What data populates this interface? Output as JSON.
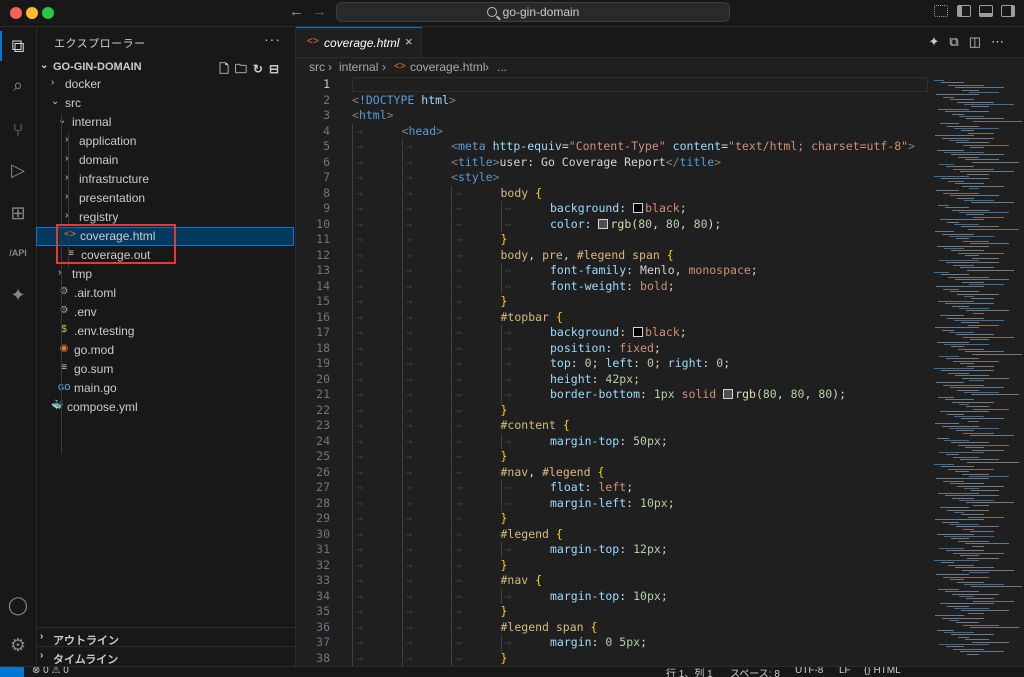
{
  "window": {
    "command_center": "go-gin-domain",
    "back_arrow": "←",
    "forward_arrow": "→"
  },
  "activity_bar": [
    {
      "name": "explorer-icon",
      "glyph": "⧉",
      "active": true
    },
    {
      "name": "search-icon",
      "glyph": "⌕"
    },
    {
      "name": "source-control-icon",
      "glyph": "⑂"
    },
    {
      "name": "run-debug-icon",
      "glyph": "▷"
    },
    {
      "name": "extensions-icon",
      "glyph": "⊞"
    },
    {
      "name": "api-icon",
      "glyph": "/API"
    },
    {
      "name": "copilot-icon",
      "glyph": "✦"
    }
  ],
  "activity_bottom": [
    {
      "name": "account-icon",
      "glyph": "◯"
    },
    {
      "name": "settings-gear-icon",
      "glyph": "⚙"
    }
  ],
  "sidebar": {
    "title": "エクスプローラー",
    "more": "···",
    "project": "GO-GIN-DOMAIN",
    "outline": "アウトライン",
    "timeline": "タイムライン"
  },
  "tree": [
    {
      "name": "docker",
      "type": "folder",
      "open": false,
      "depth": 1
    },
    {
      "name": "src",
      "type": "folder",
      "open": true,
      "depth": 1
    },
    {
      "name": "internal",
      "type": "folder",
      "open": true,
      "depth": 2
    },
    {
      "name": "application",
      "type": "folder",
      "open": false,
      "depth": 3
    },
    {
      "name": "domain",
      "type": "folder",
      "open": false,
      "depth": 3
    },
    {
      "name": "infrastructure",
      "type": "folder",
      "open": false,
      "depth": 3
    },
    {
      "name": "presentation",
      "type": "folder",
      "open": false,
      "depth": 3
    },
    {
      "name": "registry",
      "type": "folder",
      "open": false,
      "depth": 3
    },
    {
      "name": "coverage.html",
      "type": "file",
      "icon": "<>",
      "color": "#e37933",
      "depth": 3,
      "selected": true
    },
    {
      "name": "coverage.out",
      "type": "file",
      "icon": "≡",
      "color": "#cccccc",
      "depth": 3
    },
    {
      "name": "tmp",
      "type": "folder",
      "open": false,
      "depth": 2
    },
    {
      "name": ".air.toml",
      "type": "file",
      "icon": "⚙",
      "color": "#9aa4ad",
      "depth": 2
    },
    {
      "name": ".env",
      "type": "file",
      "icon": "⚙",
      "color": "#9aa4ad",
      "depth": 2
    },
    {
      "name": ".env.testing",
      "type": "file",
      "icon": "$",
      "color": "#cbcb41",
      "depth": 2
    },
    {
      "name": "go.mod",
      "type": "file",
      "icon": "◉",
      "color": "#e37933",
      "depth": 2
    },
    {
      "name": "go.sum",
      "type": "file",
      "icon": "≡",
      "color": "#cccccc",
      "depth": 2
    },
    {
      "name": "main.go",
      "type": "file",
      "icon": "GO",
      "color": "#519aba",
      "depth": 2
    },
    {
      "name": "compose.yml",
      "type": "file",
      "icon": "🐳",
      "color": "#e0443e",
      "depth": 1
    }
  ],
  "editor": {
    "tab_label": "coverage.html",
    "tab_close": "×",
    "breadcrumb": [
      "src",
      "internal",
      "coverage.html",
      "..."
    ]
  },
  "code_lines": [
    {
      "indent": 0,
      "tokens": []
    },
    {
      "indent": 0,
      "tokens": [
        [
          "tk-gray",
          "<"
        ],
        [
          "tk-tag",
          "!DOCTYPE"
        ],
        [
          "tk-txt",
          " "
        ],
        [
          "tk-attr",
          "html"
        ],
        [
          "tk-gray",
          ">"
        ]
      ]
    },
    {
      "indent": 0,
      "tokens": [
        [
          "tk-gray",
          "<"
        ],
        [
          "tk-tag",
          "html"
        ],
        [
          "tk-gray",
          ">"
        ]
      ]
    },
    {
      "indent": 1,
      "tokens": [
        [
          "tk-gray",
          "<"
        ],
        [
          "tk-tag",
          "head"
        ],
        [
          "tk-gray",
          ">"
        ]
      ]
    },
    {
      "indent": 2,
      "tokens": [
        [
          "tk-gray",
          "<"
        ],
        [
          "tk-tag",
          "meta"
        ],
        [
          "tk-txt",
          " "
        ],
        [
          "tk-attr",
          "http-equiv"
        ],
        [
          "tk-txt",
          "="
        ],
        [
          "tk-str",
          "\"Content-Type\""
        ],
        [
          "tk-txt",
          " "
        ],
        [
          "tk-attr",
          "content"
        ],
        [
          "tk-txt",
          "="
        ],
        [
          "tk-str",
          "\"text/html; charset=utf-8\""
        ],
        [
          "tk-gray",
          ">"
        ]
      ]
    },
    {
      "indent": 2,
      "tokens": [
        [
          "tk-gray",
          "<"
        ],
        [
          "tk-tag",
          "title"
        ],
        [
          "tk-gray",
          ">"
        ],
        [
          "tk-txt",
          "user: Go Coverage Report"
        ],
        [
          "tk-gray",
          "</"
        ],
        [
          "tk-tag",
          "title"
        ],
        [
          "tk-gray",
          ">"
        ]
      ]
    },
    {
      "indent": 2,
      "tokens": [
        [
          "tk-gray",
          "<"
        ],
        [
          "tk-tag",
          "style"
        ],
        [
          "tk-gray",
          ">"
        ]
      ]
    },
    {
      "indent": 3,
      "tokens": [
        [
          "tk-sel",
          "body"
        ],
        [
          "tk-txt",
          " "
        ],
        [
          "tk-brace",
          "{"
        ]
      ]
    },
    {
      "indent": 4,
      "tokens": [
        [
          "tk-prop",
          "background"
        ],
        [
          "tk-txt",
          ": "
        ],
        [
          "swatch",
          "#000000"
        ],
        [
          "tk-val",
          "black"
        ],
        [
          "tk-txt",
          ";"
        ]
      ]
    },
    {
      "indent": 4,
      "tokens": [
        [
          "tk-prop",
          "color"
        ],
        [
          "tk-txt",
          ": "
        ],
        [
          "swatch",
          "#505050"
        ],
        [
          "tk-fn",
          "rgb"
        ],
        [
          "tk-txt",
          "("
        ],
        [
          "tk-num",
          "80"
        ],
        [
          "tk-txt",
          ", "
        ],
        [
          "tk-num",
          "80"
        ],
        [
          "tk-txt",
          ", "
        ],
        [
          "tk-num",
          "80"
        ],
        [
          "tk-txt",
          ");"
        ]
      ]
    },
    {
      "indent": 3,
      "tokens": [
        [
          "tk-brace",
          "}"
        ]
      ]
    },
    {
      "indent": 3,
      "tokens": [
        [
          "tk-sel",
          "body"
        ],
        [
          "tk-txt",
          ", "
        ],
        [
          "tk-sel",
          "pre"
        ],
        [
          "tk-txt",
          ", "
        ],
        [
          "tk-sel",
          "#legend span"
        ],
        [
          "tk-txt",
          " "
        ],
        [
          "tk-brace",
          "{"
        ]
      ]
    },
    {
      "indent": 4,
      "tokens": [
        [
          "tk-prop",
          "font-family"
        ],
        [
          "tk-txt",
          ": Menlo, "
        ],
        [
          "tk-val",
          "monospace"
        ],
        [
          "tk-txt",
          ";"
        ]
      ]
    },
    {
      "indent": 4,
      "tokens": [
        [
          "tk-prop",
          "font-weight"
        ],
        [
          "tk-txt",
          ": "
        ],
        [
          "tk-val",
          "bold"
        ],
        [
          "tk-txt",
          ";"
        ]
      ]
    },
    {
      "indent": 3,
      "tokens": [
        [
          "tk-brace",
          "}"
        ]
      ]
    },
    {
      "indent": 3,
      "tokens": [
        [
          "tk-sel",
          "#topbar"
        ],
        [
          "tk-txt",
          " "
        ],
        [
          "tk-brace",
          "{"
        ]
      ]
    },
    {
      "indent": 4,
      "tokens": [
        [
          "tk-prop",
          "background"
        ],
        [
          "tk-txt",
          ": "
        ],
        [
          "swatch",
          "#000000"
        ],
        [
          "tk-val",
          "black"
        ],
        [
          "tk-txt",
          ";"
        ]
      ]
    },
    {
      "indent": 4,
      "tokens": [
        [
          "tk-prop",
          "position"
        ],
        [
          "tk-txt",
          ": "
        ],
        [
          "tk-val",
          "fixed"
        ],
        [
          "tk-txt",
          ";"
        ]
      ]
    },
    {
      "indent": 4,
      "tokens": [
        [
          "tk-prop",
          "top"
        ],
        [
          "tk-txt",
          ": "
        ],
        [
          "tk-num",
          "0"
        ],
        [
          "tk-txt",
          "; "
        ],
        [
          "tk-prop",
          "left"
        ],
        [
          "tk-txt",
          ": "
        ],
        [
          "tk-num",
          "0"
        ],
        [
          "tk-txt",
          "; "
        ],
        [
          "tk-prop",
          "right"
        ],
        [
          "tk-txt",
          ": "
        ],
        [
          "tk-num",
          "0"
        ],
        [
          "tk-txt",
          ";"
        ]
      ]
    },
    {
      "indent": 4,
      "tokens": [
        [
          "tk-prop",
          "height"
        ],
        [
          "tk-txt",
          ": "
        ],
        [
          "tk-num",
          "42px"
        ],
        [
          "tk-txt",
          ";"
        ]
      ]
    },
    {
      "indent": 4,
      "tokens": [
        [
          "tk-prop",
          "border-bottom"
        ],
        [
          "tk-txt",
          ": "
        ],
        [
          "tk-num",
          "1px"
        ],
        [
          "tk-txt",
          " "
        ],
        [
          "tk-val",
          "solid"
        ],
        [
          "tk-txt",
          " "
        ],
        [
          "swatch",
          "#505050"
        ],
        [
          "tk-fn",
          "rgb"
        ],
        [
          "tk-txt",
          "("
        ],
        [
          "tk-num",
          "80"
        ],
        [
          "tk-txt",
          ", "
        ],
        [
          "tk-num",
          "80"
        ],
        [
          "tk-txt",
          ", "
        ],
        [
          "tk-num",
          "80"
        ],
        [
          "tk-txt",
          ");"
        ]
      ]
    },
    {
      "indent": 3,
      "tokens": [
        [
          "tk-brace",
          "}"
        ]
      ]
    },
    {
      "indent": 3,
      "tokens": [
        [
          "tk-sel",
          "#content"
        ],
        [
          "tk-txt",
          " "
        ],
        [
          "tk-brace",
          "{"
        ]
      ]
    },
    {
      "indent": 4,
      "tokens": [
        [
          "tk-prop",
          "margin-top"
        ],
        [
          "tk-txt",
          ": "
        ],
        [
          "tk-num",
          "50px"
        ],
        [
          "tk-txt",
          ";"
        ]
      ]
    },
    {
      "indent": 3,
      "tokens": [
        [
          "tk-brace",
          "}"
        ]
      ]
    },
    {
      "indent": 3,
      "tokens": [
        [
          "tk-sel",
          "#nav"
        ],
        [
          "tk-txt",
          ", "
        ],
        [
          "tk-sel",
          "#legend"
        ],
        [
          "tk-txt",
          " "
        ],
        [
          "tk-brace",
          "{"
        ]
      ]
    },
    {
      "indent": 4,
      "tokens": [
        [
          "tk-prop",
          "float"
        ],
        [
          "tk-txt",
          ": "
        ],
        [
          "tk-val",
          "left"
        ],
        [
          "tk-txt",
          ";"
        ]
      ]
    },
    {
      "indent": 4,
      "tokens": [
        [
          "tk-prop",
          "margin-left"
        ],
        [
          "tk-txt",
          ": "
        ],
        [
          "tk-num",
          "10px"
        ],
        [
          "tk-txt",
          ";"
        ]
      ]
    },
    {
      "indent": 3,
      "tokens": [
        [
          "tk-brace",
          "}"
        ]
      ]
    },
    {
      "indent": 3,
      "tokens": [
        [
          "tk-sel",
          "#legend"
        ],
        [
          "tk-txt",
          " "
        ],
        [
          "tk-brace",
          "{"
        ]
      ]
    },
    {
      "indent": 4,
      "tokens": [
        [
          "tk-prop",
          "margin-top"
        ],
        [
          "tk-txt",
          ": "
        ],
        [
          "tk-num",
          "12px"
        ],
        [
          "tk-txt",
          ";"
        ]
      ]
    },
    {
      "indent": 3,
      "tokens": [
        [
          "tk-brace",
          "}"
        ]
      ]
    },
    {
      "indent": 3,
      "tokens": [
        [
          "tk-sel",
          "#nav"
        ],
        [
          "tk-txt",
          " "
        ],
        [
          "tk-brace",
          "{"
        ]
      ]
    },
    {
      "indent": 4,
      "tokens": [
        [
          "tk-prop",
          "margin-top"
        ],
        [
          "tk-txt",
          ": "
        ],
        [
          "tk-num",
          "10px"
        ],
        [
          "tk-txt",
          ";"
        ]
      ]
    },
    {
      "indent": 3,
      "tokens": [
        [
          "tk-brace",
          "}"
        ]
      ]
    },
    {
      "indent": 3,
      "tokens": [
        [
          "tk-sel",
          "#legend span"
        ],
        [
          "tk-txt",
          " "
        ],
        [
          "tk-brace",
          "{"
        ]
      ]
    },
    {
      "indent": 4,
      "tokens": [
        [
          "tk-prop",
          "margin"
        ],
        [
          "tk-txt",
          ": "
        ],
        [
          "tk-num",
          "0"
        ],
        [
          "tk-txt",
          " "
        ],
        [
          "tk-num",
          "5px"
        ],
        [
          "tk-txt",
          ";"
        ]
      ]
    },
    {
      "indent": 3,
      "tokens": [
        [
          "tk-brace",
          "}"
        ]
      ]
    }
  ],
  "status": {
    "problems": "⊗ 0 ⚠ 0",
    "position": "行 1、列 1",
    "spaces": "スペース: 8",
    "encoding": "UTF-8",
    "eol": "LF",
    "language": "{} HTML"
  },
  "colors": {
    "accent": "#0078d4",
    "highlight_box": "#e53935"
  }
}
